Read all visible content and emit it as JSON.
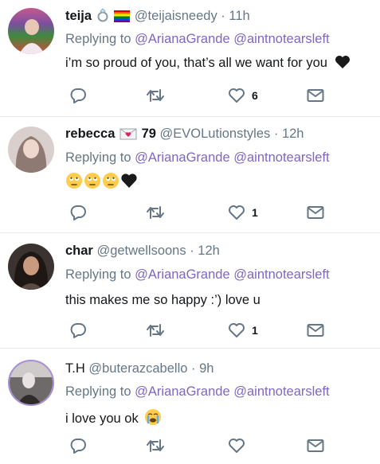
{
  "replies": [
    {
      "name": "teija",
      "badges": [
        "ring-icon",
        "rainbow-flag-icon"
      ],
      "handle": "@teijaisneedy",
      "sep": "·",
      "time": "11h",
      "replying_prefix": "Replying to",
      "mentions": [
        "@ArianaGrande",
        "@aintnotearsleft"
      ],
      "text": "i’m so proud of you, that’s all we want for you",
      "emoji": [
        "black-heart-icon"
      ],
      "likes": "6"
    },
    {
      "name": "rebecca",
      "badges": [
        "love-letter-icon"
      ],
      "badge_text": "79",
      "handle": "@EVOLutionstyles",
      "sep": "·",
      "time": "12h",
      "replying_prefix": "Replying to",
      "mentions": [
        "@ArianaGrande",
        "@aintnotearsleft"
      ],
      "text": "",
      "emoji": [
        "face-with-rolling-eyes-icon",
        "face-with-rolling-eyes-icon",
        "face-with-rolling-eyes-icon",
        "black-heart-icon"
      ],
      "likes": "1"
    },
    {
      "name": "char",
      "handle": "@getwellsoons",
      "sep": "·",
      "time": "12h",
      "replying_prefix": "Replying to",
      "mentions": [
        "@ArianaGrande",
        "@aintnotearsleft"
      ],
      "text": "this makes me so happy :’) love u",
      "likes": "1"
    },
    {
      "name": "T.H",
      "handle": "@buterazcabello",
      "sep": "·",
      "time": "9h",
      "replying_prefix": "Replying to",
      "mentions": [
        "@ArianaGrande",
        "@aintnotearsleft"
      ],
      "text": "i love you ok",
      "emoji": [
        "loudly-crying-face-icon"
      ],
      "likes": ""
    }
  ],
  "colors": {
    "mention": "#8066c4",
    "secondary": "#657786",
    "divider": "#e6ecf0",
    "icon": "#657786"
  }
}
